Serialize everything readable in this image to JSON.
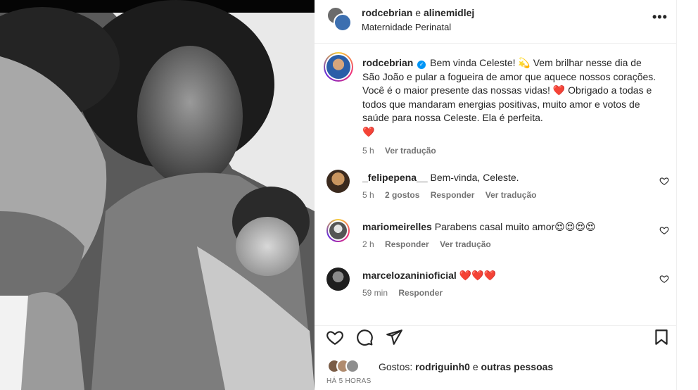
{
  "header": {
    "user1": "rodcebrian",
    "separator": "e",
    "user2": "alinemidlej",
    "location": "Maternidade Perinatal",
    "more_icon": "more-horizontal-icon"
  },
  "caption": {
    "username": "rodcebrian",
    "verified_icon": "verified-badge-icon",
    "text_part1": "Bem vinda Celeste! 💫 Vem brilhar nesse dia de São João e pular a fogueira de amor que aquece nossos corações. Você é o maior presente das nossas vidas!",
    "heart1": "❤️",
    "text_part2": "Obrigado a todas e todos que mandaram energias positivas, muito amor e votos de saúde para nossa Celeste. Ela é perfeita.",
    "heart2": "❤️",
    "time": "5 h",
    "translate": "Ver tradução"
  },
  "comments": [
    {
      "username": "_felipepena__",
      "text": "Bem-vinda, Celeste.",
      "time": "5 h",
      "likes": "2 gostos",
      "reply": "Responder",
      "translate": "Ver tradução"
    },
    {
      "username": "mariomeirelles",
      "text": "Parabens casal muito amor😍😍😍😍",
      "time": "2 h",
      "reply": "Responder",
      "translate": "Ver tradução"
    },
    {
      "username": "marcelozaninioficial",
      "text": "❤️❤️❤️",
      "time": "59 min",
      "reply": "Responder"
    }
  ],
  "actions": {
    "like_icon": "heart-outline-icon",
    "comment_icon": "comment-bubble-icon",
    "share_icon": "send-icon",
    "save_icon": "bookmark-icon"
  },
  "likes": {
    "prefix": "Gostos:",
    "user": "rodriguinh0",
    "connector": "e",
    "others": "outras pessoas"
  },
  "time_ago": "HÁ 5 HORAS",
  "colors": {
    "text": "#262626",
    "secondary": "#737373",
    "verified": "#0095f6",
    "heart": "#e0245e",
    "border": "#efefef"
  }
}
